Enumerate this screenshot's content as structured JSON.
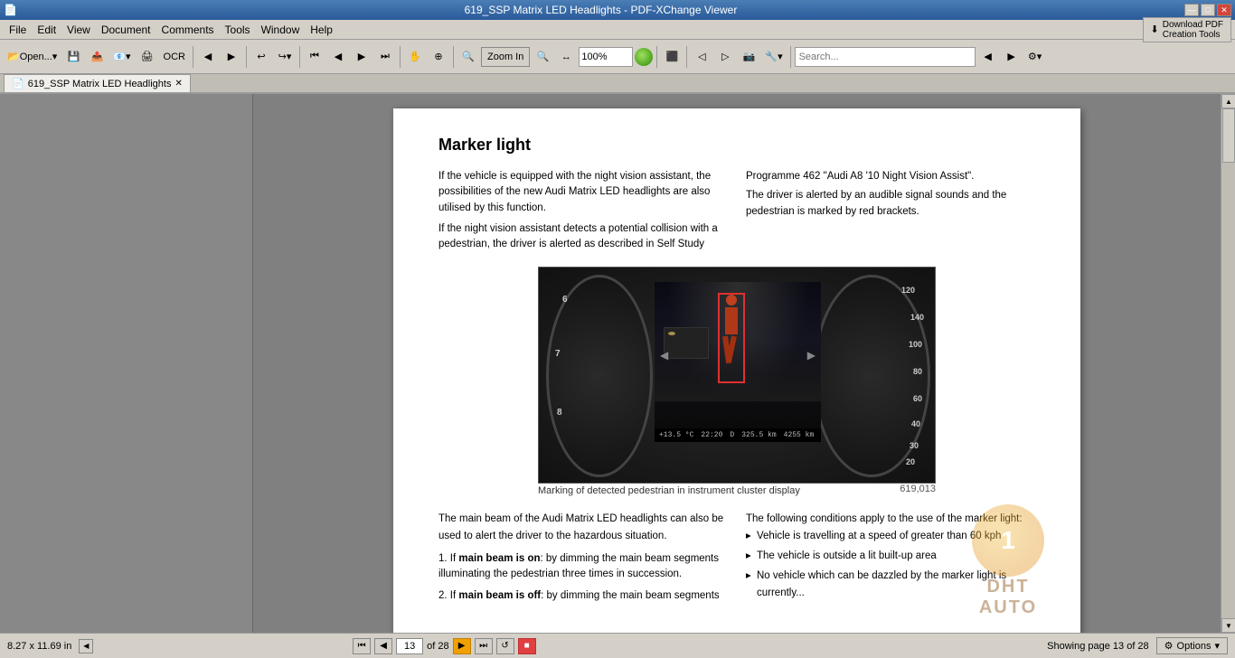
{
  "titleBar": {
    "title": "619_SSP Matrix LED Headlights - PDF-XChange Viewer",
    "minBtn": "—",
    "maxBtn": "□",
    "closeBtn": "✕"
  },
  "menuBar": {
    "items": [
      "File",
      "Edit",
      "View",
      "Document",
      "Comments",
      "Tools",
      "Window",
      "Help"
    ],
    "downloadBtn": "Download PDF\nCreation Tools"
  },
  "toolbar": {
    "openLabel": "Open...",
    "ocrLabel": "OCR",
    "zoomInLabel": "Zoom In",
    "zoomLevel": "100%",
    "searchPlaceholder": ""
  },
  "tabBar": {
    "tabs": [
      {
        "label": "619_SSP Matrix LED Headlights",
        "active": true
      }
    ]
  },
  "pdfPage": {
    "heading": "Marker light",
    "leftCol1": "If the vehicle is equipped with the night vision assistant, the possibilities of the new Audi Matrix LED headlights are also utilised by this function.\nIf the night vision assistant detects a potential collision with a pedestrian, the driver is alerted as described in Self Study",
    "rightCol1": "Programme 462 \"Audi A8 '10 Night Vision Assist\".\nThe driver is alerted by an audible signal sounds and the pedestrian is marked by red brackets.",
    "imageCaption": "Marking of detected pedestrian in instrument cluster display",
    "imageNumber": "619,013",
    "displayInfo1": "+13.5 °C",
    "displayInfo2": "22:20",
    "displayInfo3": "D",
    "displayInfo4": "325.5 km",
    "displayInfo5": "4255 km",
    "lowerLeft": "The main beam of the Audi Matrix LED headlights can also be used to alert the driver to the hazardous situation.",
    "numberedItems": [
      {
        "num": "1.",
        "text": "If main beam is on: by dimming the main beam segments illuminating the pedestrian three times in succession."
      },
      {
        "num": "2.",
        "text": "If main beam is off: by dimming the main beam segments"
      }
    ],
    "lowerRight": "The following conditions apply to the use of the marker light:",
    "conditions": [
      "Vehicle is travelling at a speed of greater than 60 kph",
      "The vehicle is outside a lit built-up area",
      "No vehicle which can be dazzled by the marker light is currently..."
    ]
  },
  "statusBar": {
    "dimensions": "8.27 x 11.69 in",
    "currentPage": "13",
    "pageOf": "of 28",
    "optionsLabel": "Options"
  }
}
